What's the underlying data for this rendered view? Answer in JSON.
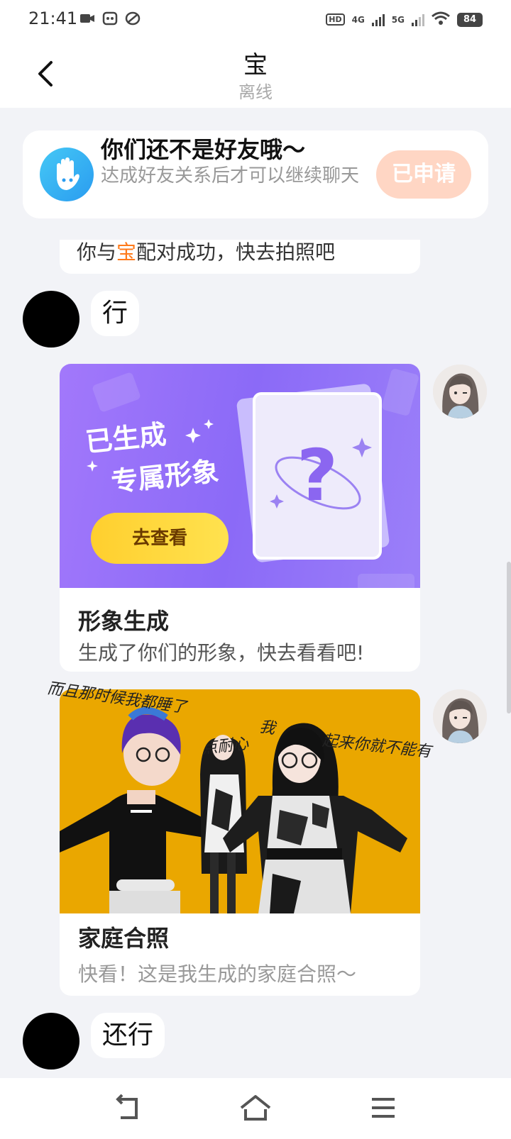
{
  "status": {
    "time": "21:41",
    "battery": "84",
    "network1": "4G",
    "network2": "5G",
    "hd": "HD"
  },
  "header": {
    "title": "宝",
    "subtitle": "离线"
  },
  "friend_notice": {
    "title": "你们还不是好友哦〜",
    "desc": "达成好友关系后才可以继续聊天",
    "button": "已申请"
  },
  "messages": {
    "system_prefix": "你与",
    "system_name": "宝",
    "system_suffix": "配对成功，快去拍照吧",
    "reply1": "行",
    "reply2": "还行"
  },
  "card_generate": {
    "banner_line1": "已生成",
    "banner_line2": "专属形象",
    "banner_button": "去查看",
    "question_mark": "?",
    "title": "形象生成",
    "desc": "生成了你们的形象，快去看看吧!"
  },
  "card_family": {
    "title": "家庭合照",
    "desc": "快看！这是我生成的家庭合照〜",
    "handwriting1": "而且那时候我都睡了",
    "handwriting2": "我",
    "handwriting3": "起来你就不能有",
    "handwriting4": "点耐心"
  },
  "colors": {
    "accent_orange": "#ff7a1a",
    "applied_button": "#ffd6c4",
    "banner_purple": "#8b6af7",
    "banner_button": "#ffd93b",
    "family_bg": "#eaa700"
  }
}
